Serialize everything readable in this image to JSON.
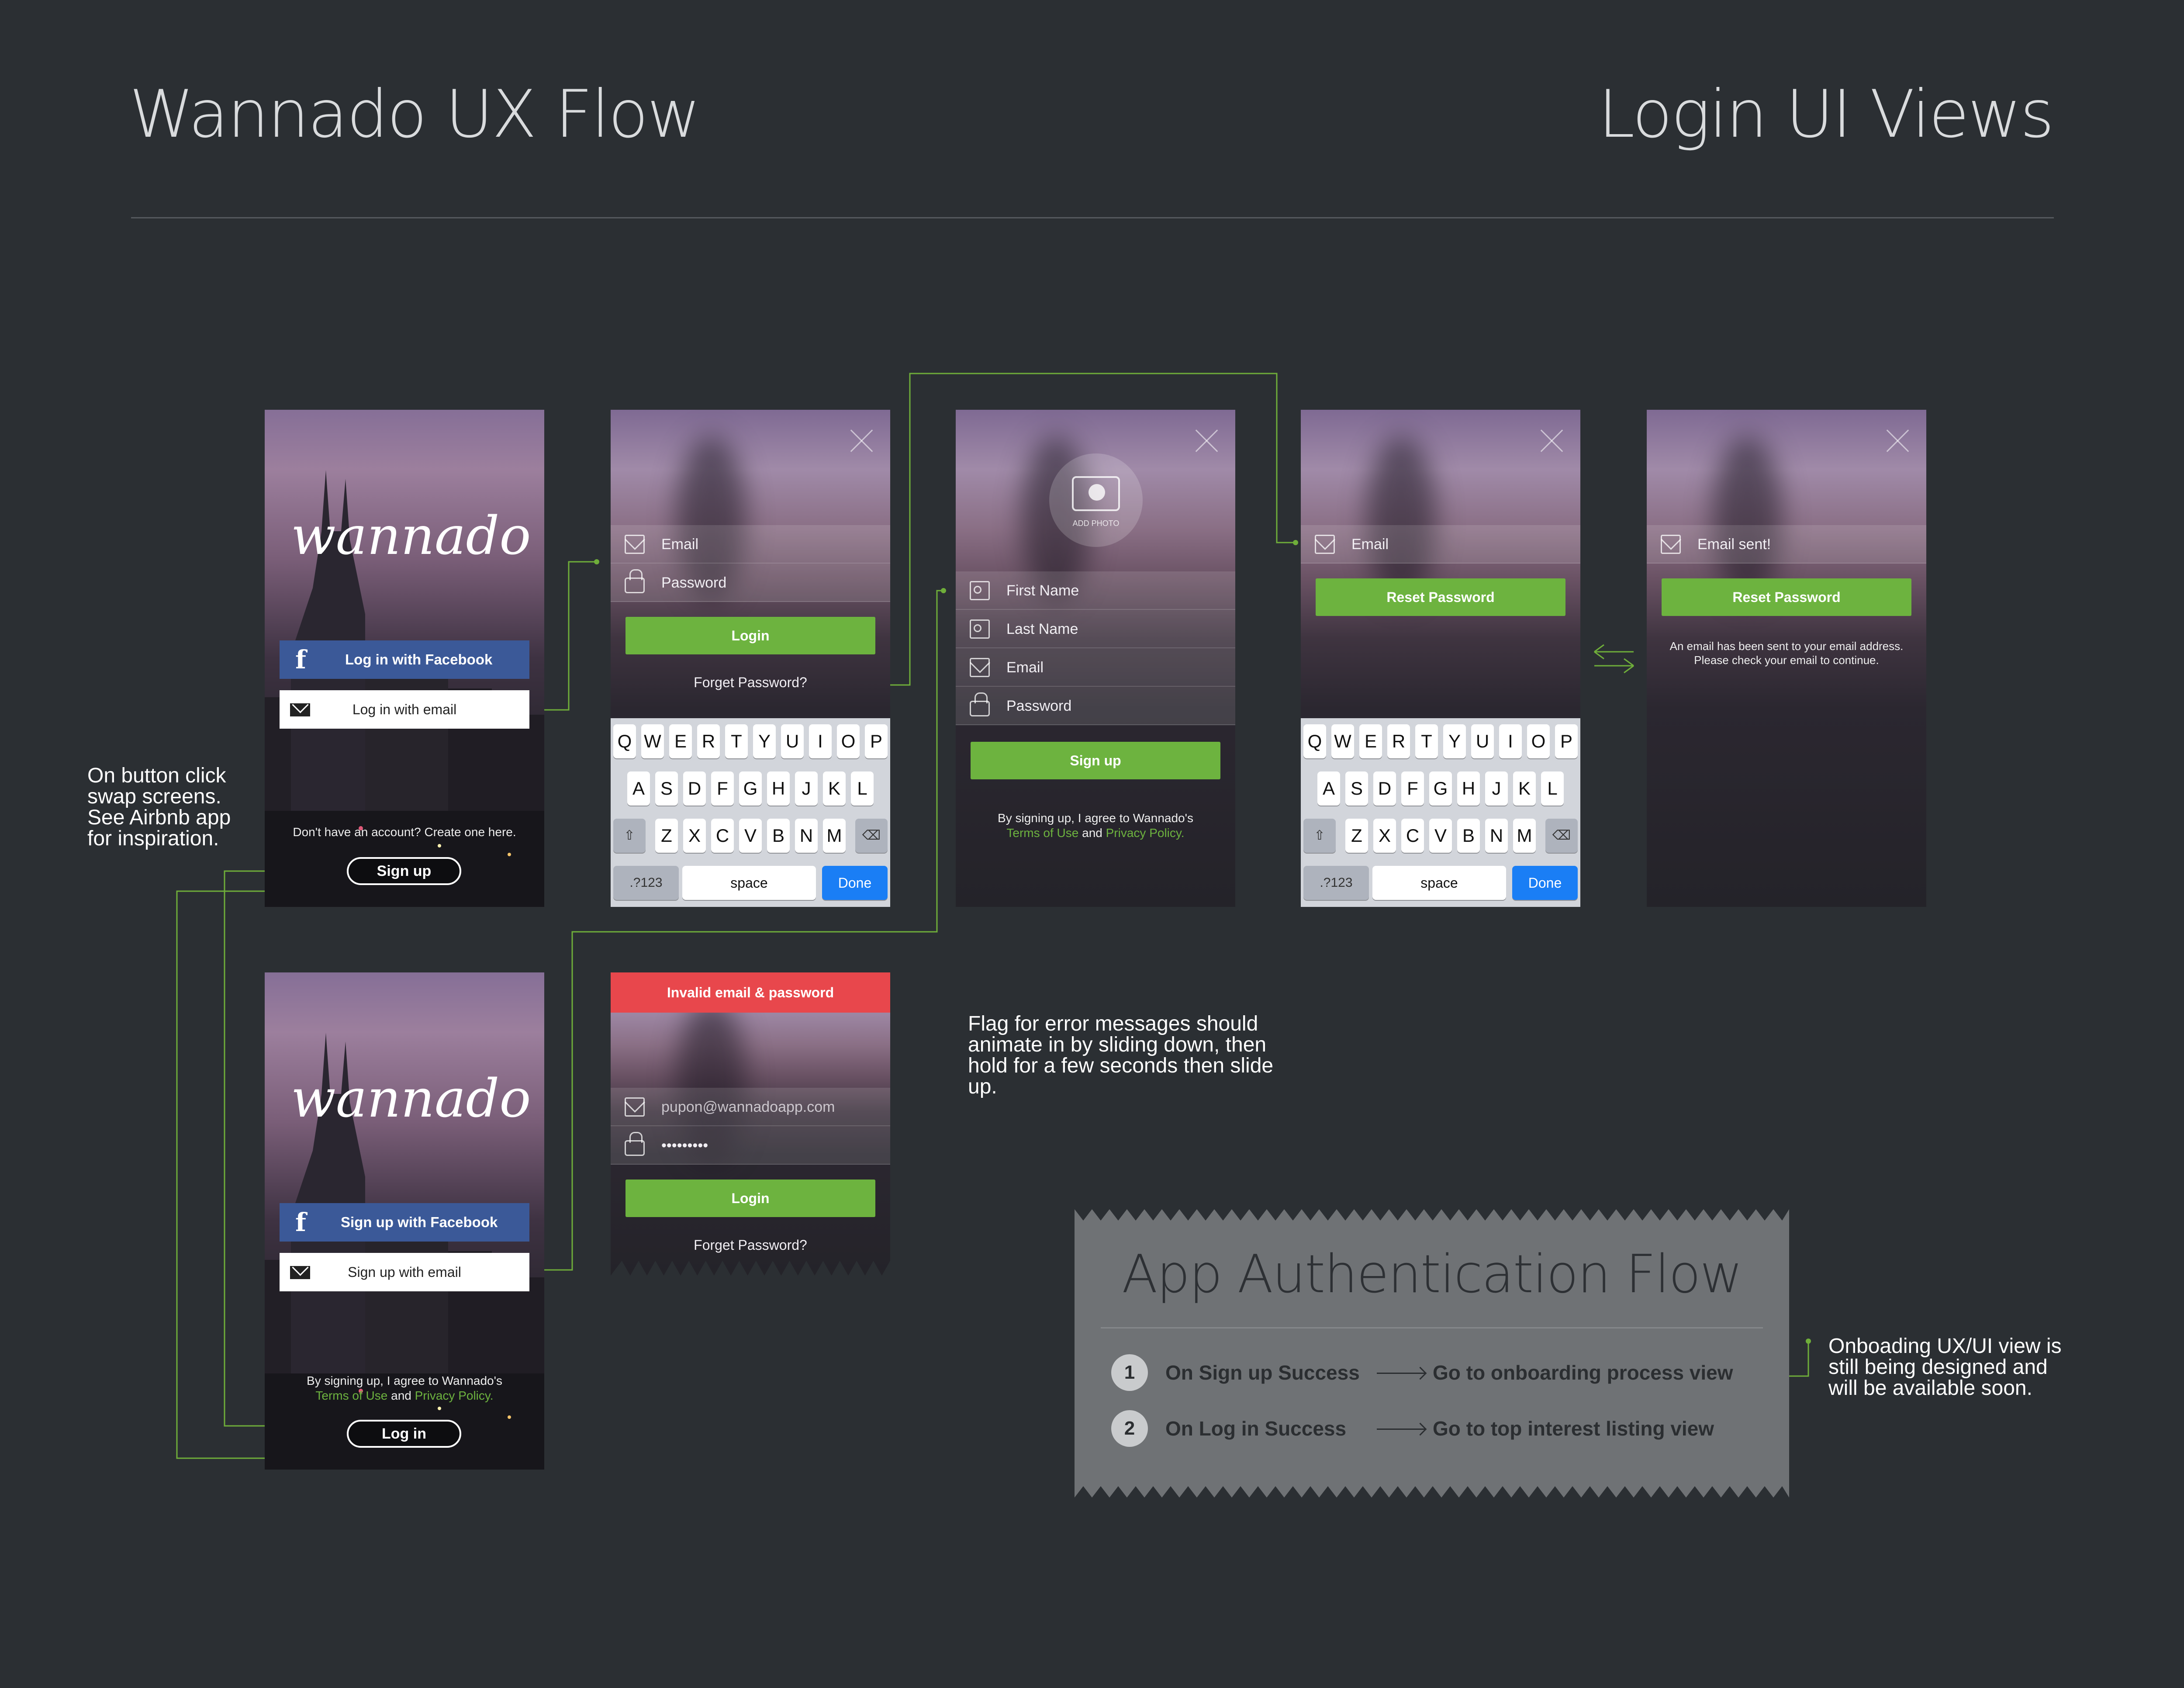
{
  "header": {
    "left_title": "Wannado UX Flow",
    "right_title": "Login UI Views"
  },
  "notes": {
    "button_swap": [
      "On button click",
      "swap screens.",
      "See Airbnb app",
      "for inspiration."
    ],
    "error_flag": [
      "Flag for error messages should",
      "animate in by sliding down, then",
      "hold for a few seconds then slide",
      "up."
    ],
    "onboarding": [
      "Onboading UX/UI view is",
      "still being designed and",
      "will be available soon."
    ]
  },
  "screen_login_landing": {
    "logo": "wannado",
    "facebook_button": "Log in with Facebook",
    "email_button": "Log in with email",
    "create_prompt": "Don't have an account? Create one here.",
    "signup_button": "Sign up"
  },
  "screen_login_form": {
    "email_placeholder": "Email",
    "password_placeholder": "Password",
    "login_button": "Login",
    "forgot_link": "Forget Password?"
  },
  "screen_signup_form": {
    "add_photo": "ADD PHOTO",
    "first_name": "First Name",
    "last_name": "Last Name",
    "email": "Email",
    "password": "Password",
    "signup_button": "Sign up",
    "terms_prefix": "By signing up, I agree to Wannado's",
    "terms_link": "Terms of Use",
    "and": "and",
    "privacy_link": "Privacy Policy."
  },
  "screen_reset": {
    "email_placeholder": "Email",
    "reset_button": "Reset Password"
  },
  "screen_reset_sent": {
    "email_value": "Email sent!",
    "reset_button": "Reset Password",
    "message_line1": "An email has been sent to your email address.",
    "message_line2": "Please check your email to continue."
  },
  "screen_signup_landing": {
    "logo": "wannado",
    "facebook_button": "Sign up with Facebook",
    "email_button": "Sign up with email",
    "terms_prefix": "By signing up, I agree to Wannado's",
    "terms_link": "Terms of Use",
    "and": "and",
    "privacy_link": "Privacy Policy.",
    "login_button": "Log in"
  },
  "screen_error": {
    "error_flag": "Invalid email & password",
    "email_value": "pupon@wannadoapp.com",
    "password_value": "•••••••••",
    "login_button": "Login",
    "forgot_link": "Forget Password?"
  },
  "keyboard": {
    "row1": [
      "Q",
      "W",
      "E",
      "R",
      "T",
      "Y",
      "U",
      "I",
      "O",
      "P"
    ],
    "row2": [
      "A",
      "S",
      "D",
      "F",
      "G",
      "H",
      "J",
      "K",
      "L"
    ],
    "row3": [
      "Z",
      "X",
      "C",
      "V",
      "B",
      "N",
      "M"
    ],
    "mode_key": ".?123",
    "space_key": "space",
    "done_key": "Done"
  },
  "auth_flow": {
    "title": "App Authentication Flow",
    "steps": [
      {
        "num": "1",
        "trigger": "On Sign up Success",
        "result": "Go to onboarding process view"
      },
      {
        "num": "2",
        "trigger": "On Log in Success",
        "result": "Go to top interest listing view"
      }
    ]
  },
  "colors": {
    "background": "#2b2f33",
    "accent_green": "#6db33f",
    "facebook_blue": "#3b5998",
    "error_red": "#e8474c",
    "ios_blue": "#1a7ef5"
  }
}
